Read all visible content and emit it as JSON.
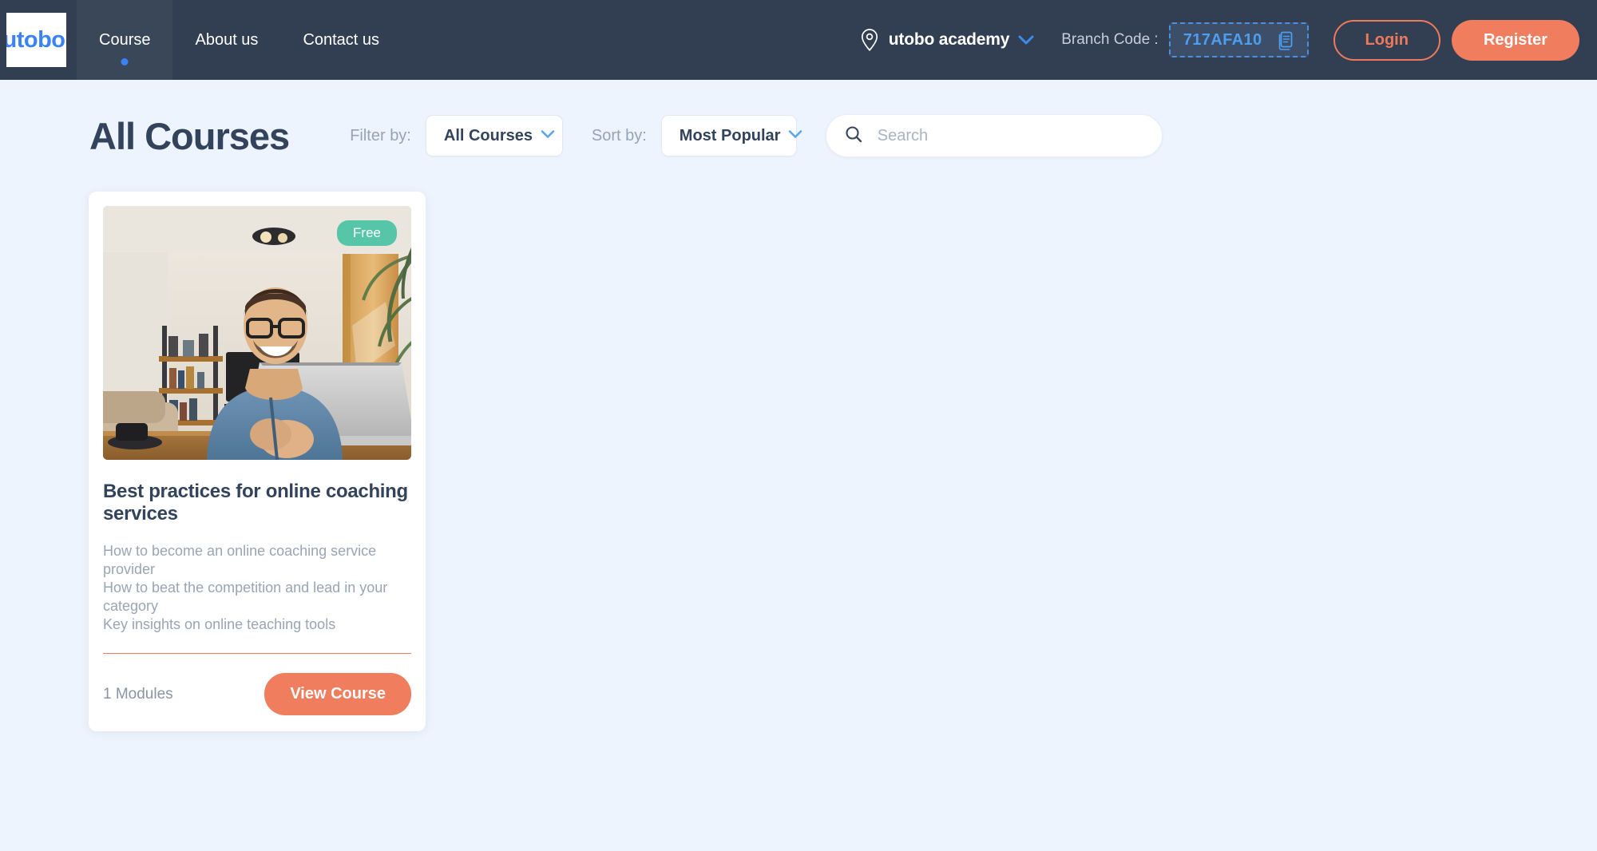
{
  "header": {
    "logo_text": "utobo",
    "nav": [
      {
        "label": "Course",
        "active": true
      },
      {
        "label": "About us",
        "active": false
      },
      {
        "label": "Contact us",
        "active": false
      }
    ],
    "academy_name": "utobo academy",
    "branch_label": "Branch Code :",
    "branch_code": "717AFA10",
    "login_label": "Login",
    "register_label": "Register",
    "accent_orange": "#ef7d5e",
    "accent_blue": "#3b82f6",
    "bar_color": "#323f52"
  },
  "toolbar": {
    "page_title": "All Courses",
    "filter_label": "Filter by:",
    "filter_value": "All Courses",
    "sort_label": "Sort by:",
    "sort_value": "Most Popular",
    "search_placeholder": "Search",
    "search_value": ""
  },
  "courses": [
    {
      "badge": "Free",
      "badge_color": "#56c5a8",
      "title": "Best practices for online coaching services",
      "description": "How to become an online coaching service provider\nHow to beat the competition and lead in your category\nKey insights on online teaching tools",
      "modules": "1 Modules",
      "cta": "View Course"
    }
  ]
}
